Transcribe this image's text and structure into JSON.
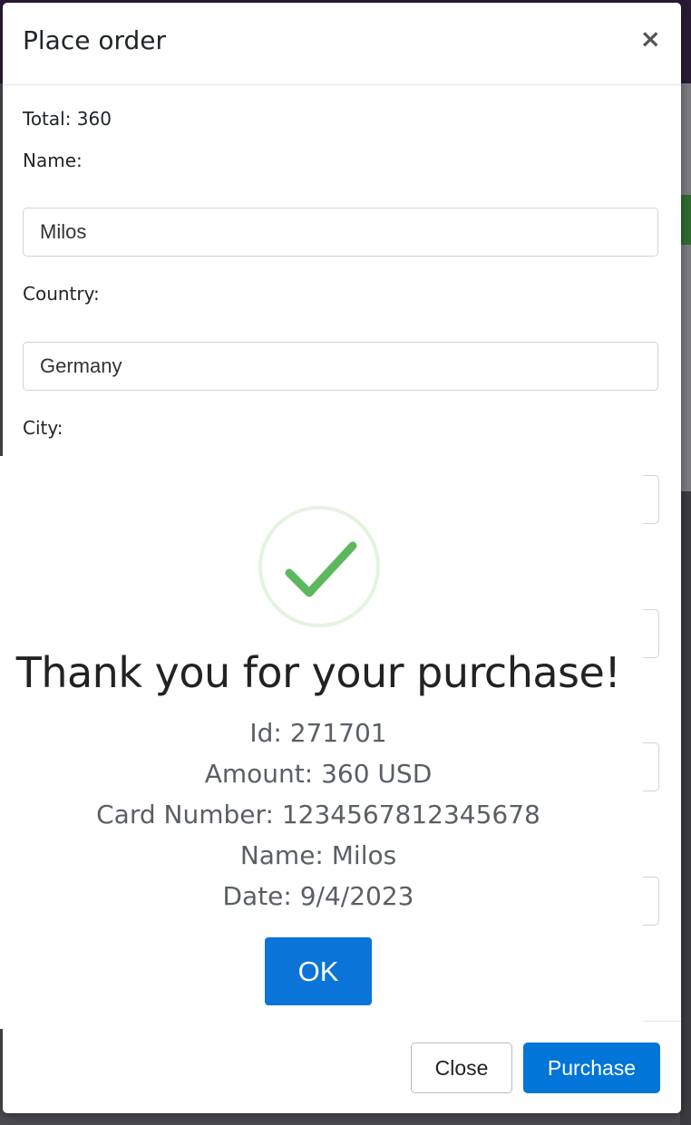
{
  "modal": {
    "title": "Place order",
    "close_symbol": "×",
    "total_label": "Total: 360",
    "fields": [
      {
        "label": "Name:",
        "value": "Milos"
      },
      {
        "label": "Country:",
        "value": "Germany"
      },
      {
        "label": "City:",
        "value": ""
      }
    ],
    "footer": {
      "close_label": "Close",
      "purchase_label": "Purchase"
    }
  },
  "alert": {
    "title": "Thank you for your purchase!",
    "lines": [
      "Id: 271701",
      "Amount: 360 USD",
      "Card Number: 1234567812345678",
      "Name: Milos",
      "Date: 9/4/2023"
    ],
    "ok_label": "OK",
    "icon": "success-check-icon"
  },
  "colors": {
    "primary": "#0275d8",
    "success_check": "#5cb85c",
    "success_ring": "#e3f3df"
  }
}
